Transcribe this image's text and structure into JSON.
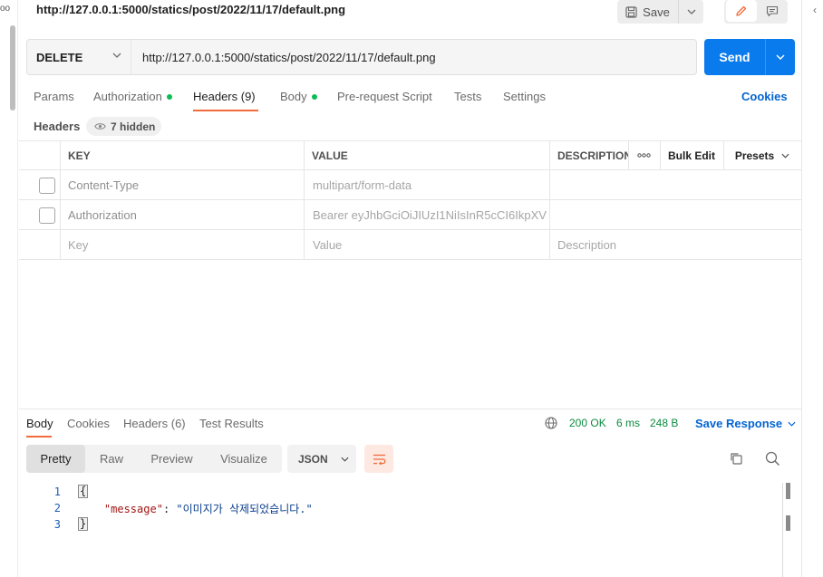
{
  "left_strip": {
    "dots": "oo"
  },
  "right_strip": {
    "chevron": "‹"
  },
  "request": {
    "title": "http://127.0.0.1:5000/statics/post/2022/11/17/default.png",
    "method": "DELETE",
    "url": "http://127.0.0.1:5000/statics/post/2022/11/17/default.png",
    "save_label": "Save",
    "send_label": "Send"
  },
  "request_tabs": [
    {
      "label": "Params"
    },
    {
      "label": "Authorization"
    },
    {
      "label": "Headers (9)"
    },
    {
      "label": "Body"
    },
    {
      "label": "Pre-request Script"
    },
    {
      "label": "Tests"
    },
    {
      "label": "Settings"
    }
  ],
  "cookies_label": "Cookies",
  "headers_section": {
    "label": "Headers",
    "hidden": "7 hidden"
  },
  "table": {
    "columns": [
      "KEY",
      "VALUE",
      "DESCRIPTION"
    ],
    "bulk_edit": "Bulk Edit",
    "presets": "Presets",
    "rows": [
      {
        "key": "Content-Type",
        "value": "multipart/form-data",
        "description": ""
      },
      {
        "key": "Authorization",
        "value": "Bearer eyJhbGciOiJIUzI1NiIsInR5cCI6IkpXV...",
        "description": ""
      }
    ],
    "placeholder": {
      "key": "Key",
      "value": "Value",
      "description": "Description"
    }
  },
  "response": {
    "tabs": [
      "Body",
      "Cookies",
      "Headers (6)",
      "Test Results"
    ],
    "status": "200 OK",
    "time": "6 ms",
    "size": "248 B",
    "save_response": "Save Response",
    "formats": [
      "Pretty",
      "Raw",
      "Preview",
      "Visualize"
    ],
    "language": "JSON",
    "lines": [
      "1",
      "2",
      "3"
    ],
    "json_key": "\"message\"",
    "json_value": "\"이미지가 삭제되었습니다.\""
  },
  "colors": {
    "accent": "#f26b3a",
    "send": "#097bed",
    "link": "#0265d2",
    "status_green": "#0b8a40",
    "dot_green": "#0cbb52"
  }
}
